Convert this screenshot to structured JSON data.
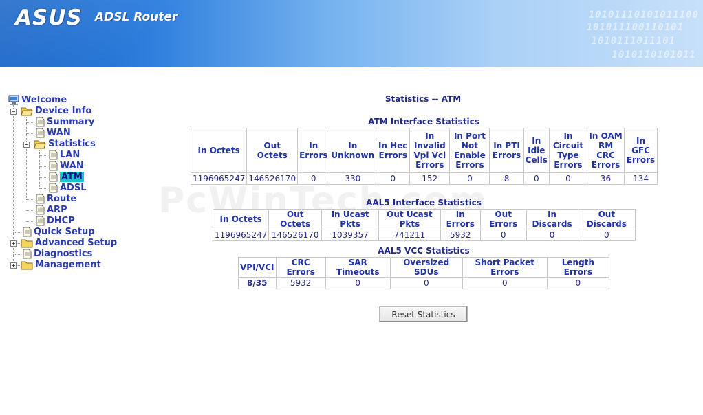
{
  "header": {
    "logo_text": "ASUS",
    "product": "ADSL Router",
    "binary_lines": [
      "10101110101011100",
      "101011100110101",
      "1010111011101",
      "1010110101011"
    ]
  },
  "watermark": "PcWinTech.com",
  "menu": {
    "welcome": "Welcome",
    "device_info": "Device Info",
    "summary": "Summary",
    "wan": "WAN",
    "statistics": "Statistics",
    "lan": "LAN",
    "stats_wan": "WAN",
    "atm": "ATM",
    "adsl": "ADSL",
    "route": "Route",
    "arp": "ARP",
    "dhcp": "DHCP",
    "quick_setup": "Quick Setup",
    "advanced_setup": "Advanced Setup",
    "diagnostics": "Diagnostics",
    "management": "Management",
    "expand_glyph": "+",
    "collapse_glyph": "−"
  },
  "page": {
    "title": "Statistics -- ATM"
  },
  "atm": {
    "title": "ATM Interface Statistics",
    "headers": [
      "In Octets",
      "Out Octets",
      "In Errors",
      "In Unknown",
      "In Hec Errors",
      "In Invalid Vpi Vci Errors",
      "In Port Not Enable Errors",
      "In PTI Errors",
      "In Idle Cells",
      "In Circuit Type Errors",
      "In OAM RM CRC Errors",
      "In GFC Errors"
    ],
    "values": [
      "1196965247",
      "146526170",
      "0",
      "330",
      "0",
      "152",
      "0",
      "8",
      "0",
      "0",
      "36",
      "134"
    ]
  },
  "aal5": {
    "title": "AAL5 Interface Statistics",
    "headers": [
      "In Octets",
      "Out Octets",
      "In Ucast Pkts",
      "Out Ucast Pkts",
      "In Errors",
      "Out Errors",
      "In Discards",
      "Out Discards"
    ],
    "values": [
      "1196965247",
      "146526170",
      "1039357",
      "741211",
      "5932",
      "0",
      "0",
      "0"
    ]
  },
  "vcc": {
    "title": "AAL5 VCC Statistics",
    "headers": [
      "VPI/VCI",
      "CRC Errors",
      "SAR Timeouts",
      "Oversized SDUs",
      "Short Packet Errors",
      "Length Errors"
    ],
    "values": [
      "8/35",
      "5932",
      "0",
      "0",
      "0",
      "0"
    ]
  },
  "reset_label": "Reset Statistics"
}
